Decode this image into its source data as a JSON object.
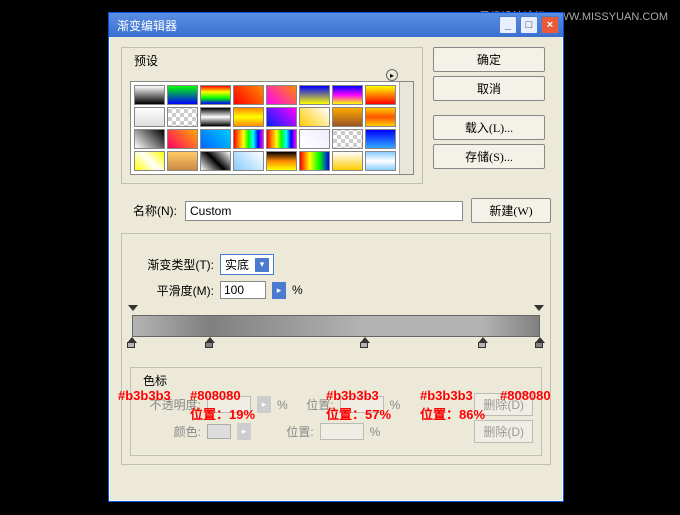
{
  "watermark": {
    "text1": "思缘设计论坛",
    "text2": "WWW.MISSYUAN.COM"
  },
  "window": {
    "title": "渐变编辑器",
    "buttons": {
      "ok": "确定",
      "cancel": "取消",
      "load": "载入(L)...",
      "save": "存储(S)..."
    },
    "presets_label": "预设"
  },
  "name": {
    "label": "名称(N):",
    "value": "Custom",
    "new_btn": "新建(W)"
  },
  "grad": {
    "type_label": "渐变类型(T):",
    "type_value": "实底",
    "smooth_label": "平滑度(M):",
    "smooth_value": "100",
    "pct": "%"
  },
  "stops": {
    "legend": "色标",
    "opacity_label": "不透明度:",
    "pos_label": "位置:",
    "pct": "%",
    "delete": "删除(D)",
    "color_label": "颜色:"
  },
  "annotations": {
    "c1": "#b3b3b3",
    "c2": "#808080",
    "c3": "#b3b3b3",
    "c4": "#b3b3b3",
    "c5": "#808080",
    "p1": "位置：19%",
    "p2": "位置：57%",
    "p3": "位置：86%"
  },
  "chart_data": {
    "type": "gradient",
    "stops": [
      {
        "pos": 0,
        "color": "#b3b3b3"
      },
      {
        "pos": 19,
        "color": "#808080"
      },
      {
        "pos": 57,
        "color": "#b3b3b3"
      },
      {
        "pos": 86,
        "color": "#b3b3b3"
      },
      {
        "pos": 100,
        "color": "#808080"
      }
    ]
  }
}
